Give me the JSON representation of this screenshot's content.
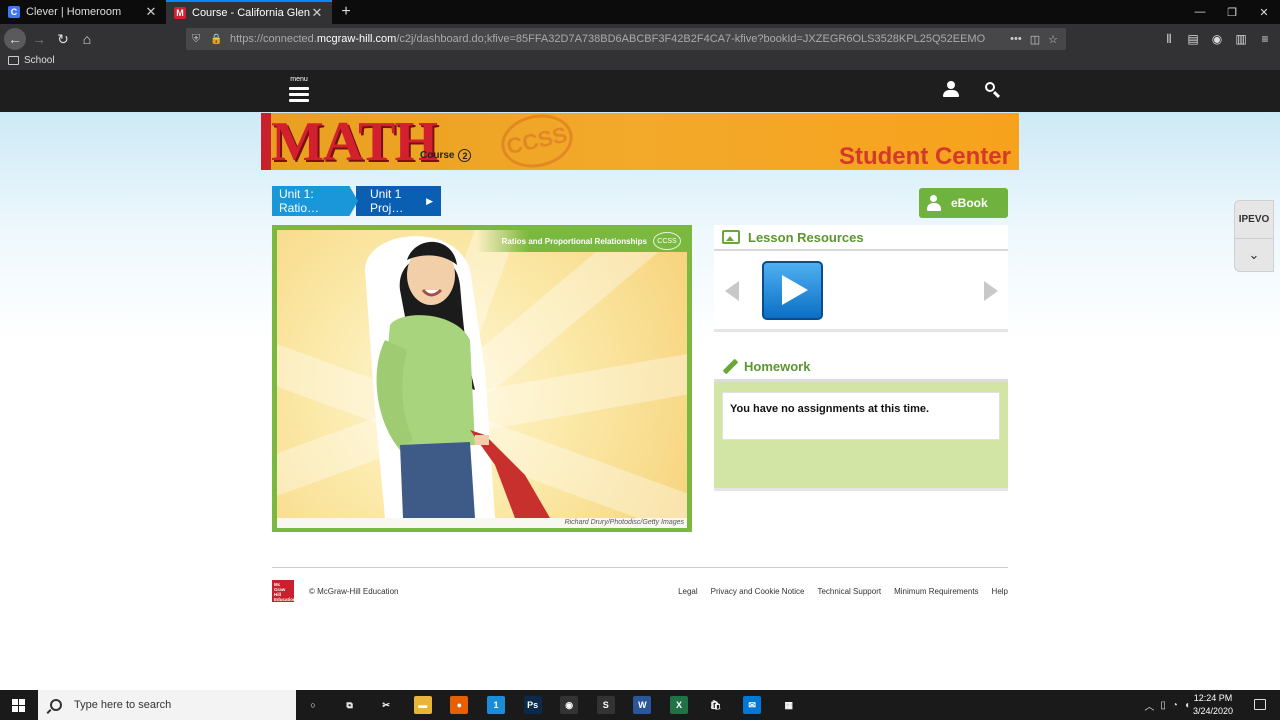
{
  "browser": {
    "tabs": [
      {
        "title": "Clever | Homeroom",
        "favicon": "C",
        "favicon_color": "#4274f6",
        "active": false
      },
      {
        "title": "Course - California Glencoe M",
        "favicon": "M",
        "favicon_color": "#d3202f",
        "active": true
      }
    ],
    "url": {
      "prefix": "https://connected.",
      "host": "mcgraw-hill.com",
      "rest": "/c2j/dashboard.do;kfive=85FFA32D7A738BD6ABCBF3F42B2F4CA7-kfive?bookId=JXZEGR6OLS3528KPL25Q52EEMO"
    },
    "bookmarks": [
      {
        "label": "School"
      }
    ]
  },
  "header": {
    "menu_label": "menu"
  },
  "banner": {
    "logo": "MATH",
    "course_label": "Course",
    "course_number": "2",
    "stamp": "CCSS",
    "title": "Student Center"
  },
  "breadcrumb": [
    {
      "label": "Unit 1: Ratio…"
    },
    {
      "label": "Unit 1 Proj…"
    }
  ],
  "ebook": {
    "label": "eBook"
  },
  "hero": {
    "label": "Ratios and Proportional Relationships",
    "badge": "CCSS",
    "credit": "Richard Drury/Photodisc/Getty Images"
  },
  "lesson_resources": {
    "title": "Lesson Resources"
  },
  "homework": {
    "title": "Homework",
    "message": "You have no assignments at this time."
  },
  "ipevo": {
    "label": "IPEVO"
  },
  "footer": {
    "logo_text": "Mc Graw Hill Education",
    "copyright": "© McGraw-Hill Education",
    "links": [
      "Legal",
      "Privacy and Cookie Notice",
      "Technical Support",
      "Minimum Requirements",
      "Help"
    ]
  },
  "taskbar": {
    "search_placeholder": "Type here to search",
    "time": "12:24 PM",
    "date": "3/24/2020",
    "apps": [
      {
        "name": "cortana-icon",
        "glyph": "○",
        "color": "transparent"
      },
      {
        "name": "task-view-icon",
        "glyph": "⧉",
        "color": "transparent"
      },
      {
        "name": "snip-icon",
        "glyph": "✂",
        "color": "transparent"
      },
      {
        "name": "file-explorer-icon",
        "glyph": "▬",
        "color": "#e8b53a"
      },
      {
        "name": "firefox-icon",
        "glyph": "●",
        "color": "#e66000"
      },
      {
        "name": "onepassword-icon",
        "glyph": "1",
        "color": "#1a8cd8"
      },
      {
        "name": "photoshop-icon",
        "glyph": "Ps",
        "color": "#0b2a4a"
      },
      {
        "name": "obs-icon",
        "glyph": "◉",
        "color": "#333"
      },
      {
        "name": "app-s-icon",
        "glyph": "S",
        "color": "#333"
      },
      {
        "name": "word-icon",
        "glyph": "W",
        "color": "#2b579a"
      },
      {
        "name": "excel-icon",
        "glyph": "X",
        "color": "#217346"
      },
      {
        "name": "store-icon",
        "glyph": "🛍",
        "color": "transparent"
      },
      {
        "name": "mail-icon",
        "glyph": "✉",
        "color": "#0078d7"
      },
      {
        "name": "calculator-icon",
        "glyph": "▦",
        "color": "transparent"
      }
    ]
  }
}
